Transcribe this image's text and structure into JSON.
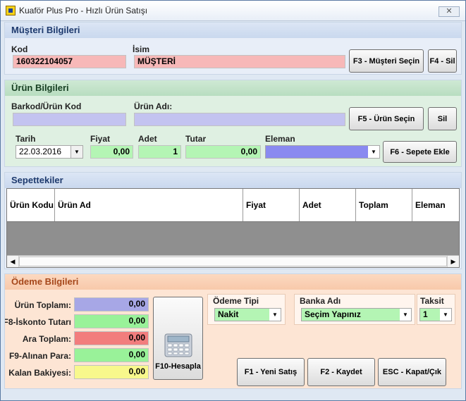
{
  "window": {
    "title": "Kuaför Plus Pro - Hızlı Ürün Satışı",
    "close_symbol": "✕"
  },
  "customer": {
    "header": "Müşteri Bilgileri",
    "code_label": "Kod",
    "code_value": "160322104057",
    "name_label": "İsim",
    "name_value": "MÜŞTERİ",
    "select_button": "F3 - Müşteri Seçin",
    "delete_button": "F4 - Sil"
  },
  "product": {
    "header": "Ürün Bilgileri",
    "barcode_label": "Barkod/Ürün Kod",
    "barcode_value": "",
    "name_label": "Ürün Adı:",
    "name_value": "",
    "select_button": "F5 - Ürün Seçin",
    "delete_button": "Sil",
    "date_label": "Tarih",
    "date_value": "22.03.2016",
    "price_label": "Fiyat",
    "price_value": "0,00",
    "qty_label": "Adet",
    "qty_value": "1",
    "total_label": "Tutar",
    "total_value": "0,00",
    "staff_label": "Eleman",
    "staff_value": "",
    "add_button": "F6 - Sepete Ekle"
  },
  "cart": {
    "header": "Sepettekiler",
    "columns": [
      "Ürün Kodu",
      "Ürün Ad",
      "Fiyat",
      "Adet",
      "Toplam",
      "Eleman"
    ],
    "scroll_left": "◀",
    "scroll_right": "▶"
  },
  "payment": {
    "header": "Ödeme Bilgileri",
    "rows": [
      {
        "label": "Ürün Toplamı:",
        "value": "0,00",
        "color": "#a7a7e6"
      },
      {
        "label": "F8-İskonto Tutarı:",
        "value": "0,00",
        "color": "#99f299"
      },
      {
        "label": "Ara Toplam:",
        "value": "0,00",
        "color": "#f27d7d"
      },
      {
        "label": "F9-Alınan Para:",
        "value": "0,00",
        "color": "#99f299"
      },
      {
        "label": "Kalan Bakiyesi:",
        "value": "0,00",
        "color": "#f8f88c"
      }
    ],
    "calc_button": "F10-Hesapla",
    "payment_type_label": "Ödeme Tipi",
    "payment_type_value": "Nakit",
    "bank_label": "Banka Adı",
    "bank_value": "Seçim Yapınız",
    "installment_label": "Taksit",
    "installment_value": "1",
    "new_sale_button": "F1 - Yeni Satış",
    "save_button": "F2 - Kaydet",
    "close_button": "ESC - Kapat/Çık"
  },
  "colors": {
    "customer_field": "#f7b8b8",
    "product_field": "#c3c3f0",
    "green_field": "#b4f5b4",
    "staff_combo": "#8a8af0",
    "payment_panel": "#fde5d4",
    "product_panel": "#dff0e2",
    "grid_body": "#8f8f8f"
  }
}
